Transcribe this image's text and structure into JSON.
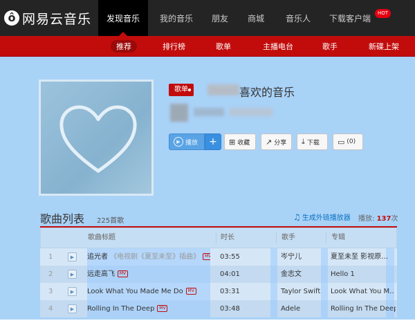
{
  "nav": {
    "logo": "网易云音乐",
    "items": [
      "发现音乐",
      "我的音乐",
      "朋友",
      "商城",
      "音乐人",
      "下载客户端"
    ],
    "hot_badge": "HOT"
  },
  "subnav": {
    "items": [
      "推荐",
      "排行榜",
      "歌单",
      "主播电台",
      "歌手",
      "新碟上架"
    ]
  },
  "playlist": {
    "tag": "歌单",
    "title": "喜欢的音乐"
  },
  "actions": {
    "play": "播放",
    "add": "+",
    "favorite": "收藏",
    "share": "分享",
    "download": "下载",
    "comment": "(0)"
  },
  "songs_section": {
    "title": "歌曲列表",
    "count": "225首歌",
    "external_player": "生成外链播放器",
    "play_count_label": "播放:",
    "play_count_value": "137",
    "play_count_unit": "次"
  },
  "table": {
    "headers": [
      "歌曲标题",
      "时长",
      "歌手",
      "专辑"
    ],
    "rows": [
      {
        "index": "1",
        "title": "追光者",
        "subtitle": "《电视剧《夏至未至》插曲》",
        "mv": "MV",
        "duration": "03:55",
        "artist": "岑宁儿",
        "album": "夏至未至 影视原…"
      },
      {
        "index": "2",
        "title": "远走高飞",
        "subtitle": "",
        "mv": "MV",
        "duration": "04:01",
        "artist": "金志文",
        "album": "Hello 1"
      },
      {
        "index": "3",
        "title": "Look What You Made Me Do",
        "subtitle": "",
        "mv": "MV",
        "duration": "03:31",
        "artist": "Taylor Swift",
        "album": "Look What You M…"
      },
      {
        "index": "4",
        "title": "Rolling In The Deep",
        "subtitle": "",
        "mv": "MV",
        "duration": "03:48",
        "artist": "Adele",
        "album": "Rolling In The Deep"
      }
    ]
  }
}
